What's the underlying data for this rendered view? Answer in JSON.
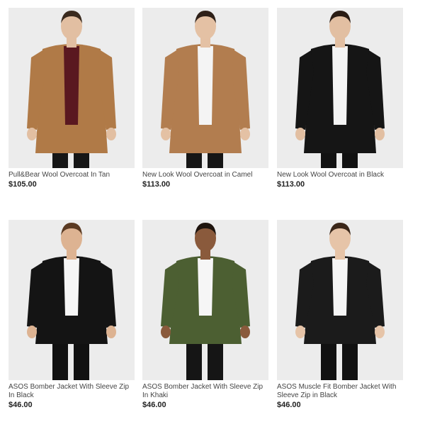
{
  "products": [
    {
      "name": "Pull&Bear Wool Overcoat In Tan",
      "price": "$105.00",
      "image": "model-in-tan-overcoat",
      "colors": {
        "garment": "#b07a47",
        "inner": "#5a1820",
        "skin": "#e2bfa2",
        "hair": "#3a2a1e",
        "pants": "#161616"
      }
    },
    {
      "name": "New Look Wool Overcoat in Camel",
      "price": "$113.00",
      "image": "model-in-camel-overcoat",
      "colors": {
        "garment": "#b27d4f",
        "inner": "#f4f4f4",
        "skin": "#e4c1a4",
        "hair": "#2e2018",
        "pants": "#161616"
      }
    },
    {
      "name": "New Look Wool Overcoat in Black",
      "price": "$113.00",
      "image": "model-in-black-overcoat",
      "colors": {
        "garment": "#151515",
        "inner": "#f4f4f4",
        "skin": "#e2bfa2",
        "hair": "#2a1c14",
        "pants": "#111111"
      }
    },
    {
      "name": "ASOS Bomber Jacket With Sleeve Zip In Black",
      "price": "$46.00",
      "image": "model-in-black-bomber-jacket",
      "colors": {
        "garment": "#141414",
        "inner": "#f6f6f6",
        "skin": "#ddb392",
        "hair": "#5a3a22",
        "pants": "#111111"
      }
    },
    {
      "name": "ASOS Bomber Jacket With Sleeve Zip In Khaki",
      "price": "$46.00",
      "image": "model-in-khaki-bomber-jacket",
      "colors": {
        "garment": "#4c5f32",
        "inner": "#f6f6f6",
        "skin": "#8a5a3c",
        "hair": "#1e140e",
        "pants": "#151515"
      }
    },
    {
      "name": "ASOS Muscle Fit Bomber Jacket With Sleeve Zip in Black",
      "price": "$46.00",
      "image": "model-in-muscle-fit-black-bomber",
      "colors": {
        "garment": "#1b1b1b",
        "inner": "#f6f6f6",
        "skin": "#e6c4a8",
        "hair": "#3a2618",
        "pants": "#111111"
      }
    }
  ]
}
